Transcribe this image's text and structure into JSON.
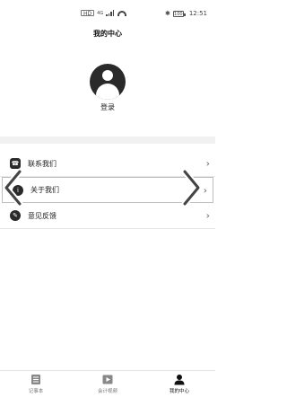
{
  "status_bar": {
    "sim_label": "HD",
    "network_label": "4G",
    "battery_level": "100",
    "time": "12:51"
  },
  "header": {
    "title": "我的中心"
  },
  "profile": {
    "login_label": "登录",
    "avatar_icon": "user-avatar-icon"
  },
  "menu": {
    "items": [
      {
        "label": "联系我们",
        "icon": "contact-icon"
      },
      {
        "label": "关于我们",
        "icon": "info-icon"
      },
      {
        "label": "意见反馈",
        "icon": "feedback-icon"
      }
    ]
  },
  "tab_bar": {
    "tabs": [
      {
        "label": "记事本",
        "icon": "notebook-icon",
        "active": false
      },
      {
        "label": "会计视频",
        "icon": "video-icon",
        "active": false
      },
      {
        "label": "我的中心",
        "icon": "user-icon",
        "active": true
      }
    ]
  },
  "colors": {
    "accent": "#2a2a2a",
    "band": "#f1f1f1",
    "text": "#222222"
  }
}
